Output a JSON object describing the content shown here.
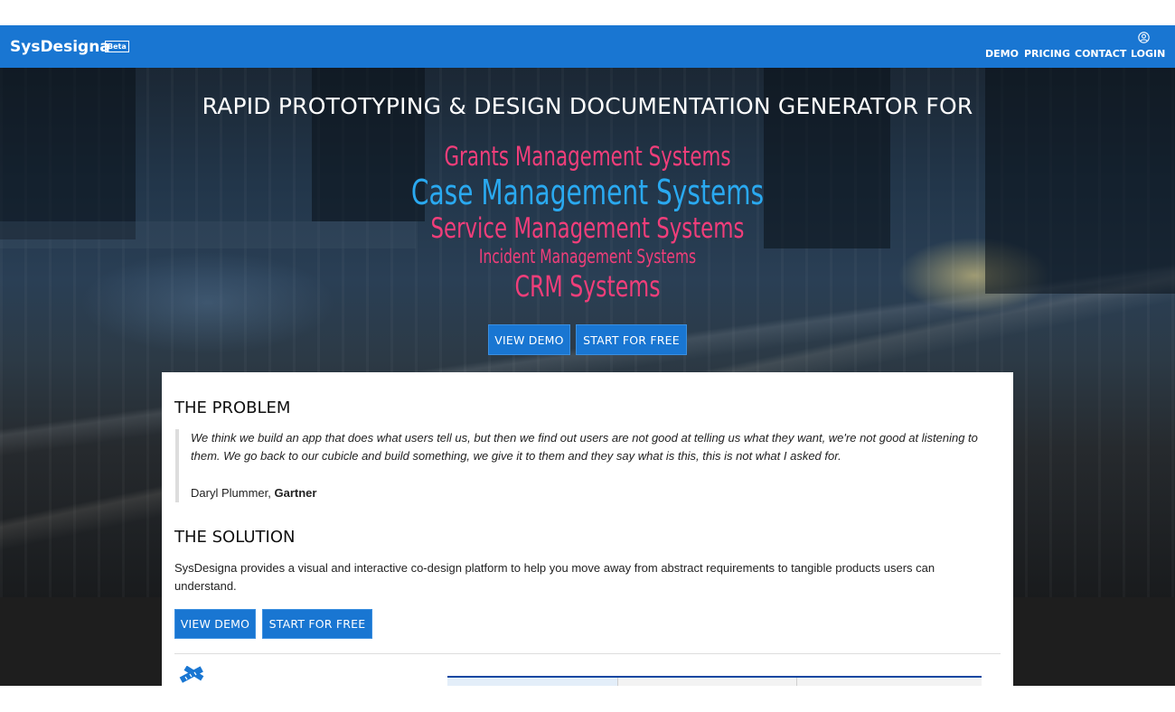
{
  "header": {
    "brand": "SysDesigna",
    "badge": "Beta",
    "nav": [
      "DEMO",
      "PRICING",
      "CONTACT",
      "LOGIN"
    ],
    "login_icon": "account-circle-icon",
    "color": "#1976d2"
  },
  "hero": {
    "title": "RAPID PROTOTYPING & DESIGN DOCUMENTATION GENERATOR FOR",
    "systems": [
      "Grants Management Systems",
      "Case Management Systems",
      "Service Management Systems",
      "Incident Management Systems",
      "CRM Systems"
    ],
    "system_colors": [
      "#f03e7a",
      "#2aa9f0",
      "#f03e7a",
      "#f03e7a",
      "#f03e7a"
    ],
    "buttons": {
      "view_demo": "VIEW DEMO",
      "start_free": "START FOR FREE"
    }
  },
  "problem": {
    "heading": "THE PROBLEM",
    "quote": "We think we build an app that does what users tell us, but then we find out users are not good at telling us what they want, we're not good at listening to them. We go back to our cubicle and build something, we give it to them and they say what is this, this is not what I asked for.",
    "author": "Daryl Plummer,",
    "organization": "Gartner"
  },
  "solution": {
    "heading": "THE SOLUTION",
    "text": "SysDesigna provides a visual and interactive co-design platform to help you move away from abstract requirements to tangible products users can understand.",
    "buttons": {
      "view_demo": "VIEW DEMO",
      "start_free": "START FOR FREE"
    }
  },
  "feature": {
    "icon": "pencil-ruler-icon"
  }
}
